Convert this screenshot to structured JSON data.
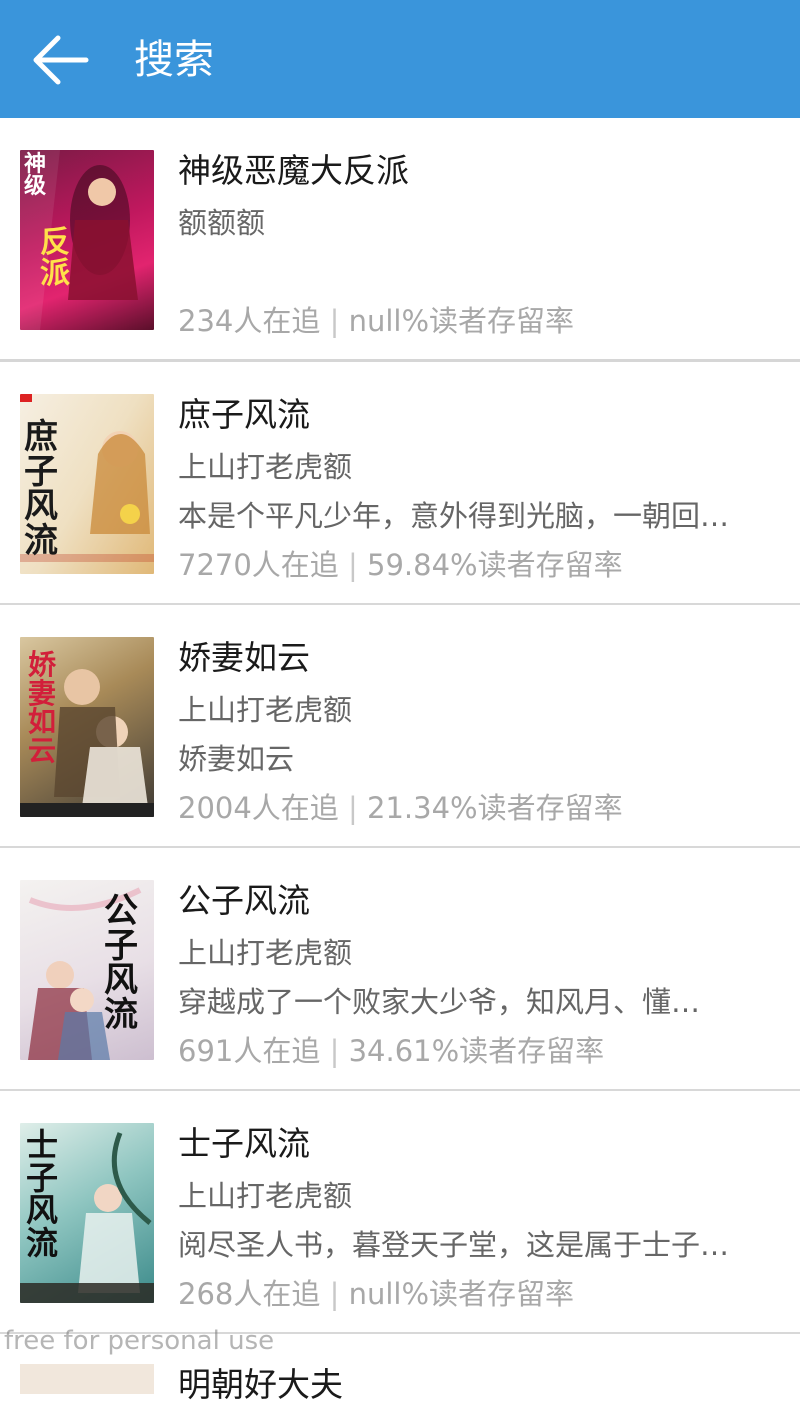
{
  "appbar": {
    "title": "搜索",
    "background": "#3a95db"
  },
  "books": [
    {
      "title": "神级恶魔大反派",
      "author": "额额额",
      "description": "",
      "followers": "234人在追",
      "retention": "null%读者存留率",
      "cover_text": "神级恶魔反派"
    },
    {
      "title": "庶子风流",
      "author": "上山打老虎额",
      "description": "本是个平凡少年，意外得到光脑，一朝回…",
      "followers": "7270人在追",
      "retention": "59.84%读者存留率",
      "cover_text": "庶子风流"
    },
    {
      "title": "娇妻如云",
      "author": "上山打老虎额",
      "description": "娇妻如云",
      "followers": "2004人在追",
      "retention": "21.34%读者存留率",
      "cover_text": "娇妻如云"
    },
    {
      "title": "公子风流",
      "author": "上山打老虎额",
      "description": "穿越成了一个败家大少爷，知风月、懂…",
      "followers": "691人在追",
      "retention": "34.61%读者存留率",
      "cover_text": "公子风流"
    },
    {
      "title": "士子风流",
      "author": "上山打老虎额",
      "description": "阅尽圣人书，暮登天子堂，这是属于士子…",
      "followers": "268人在追",
      "retention": "null%读者存留率",
      "cover_text": "士子风流"
    }
  ],
  "partial_next_title": "明朝好大夫",
  "separator": "|",
  "watermark": "free for personal use"
}
